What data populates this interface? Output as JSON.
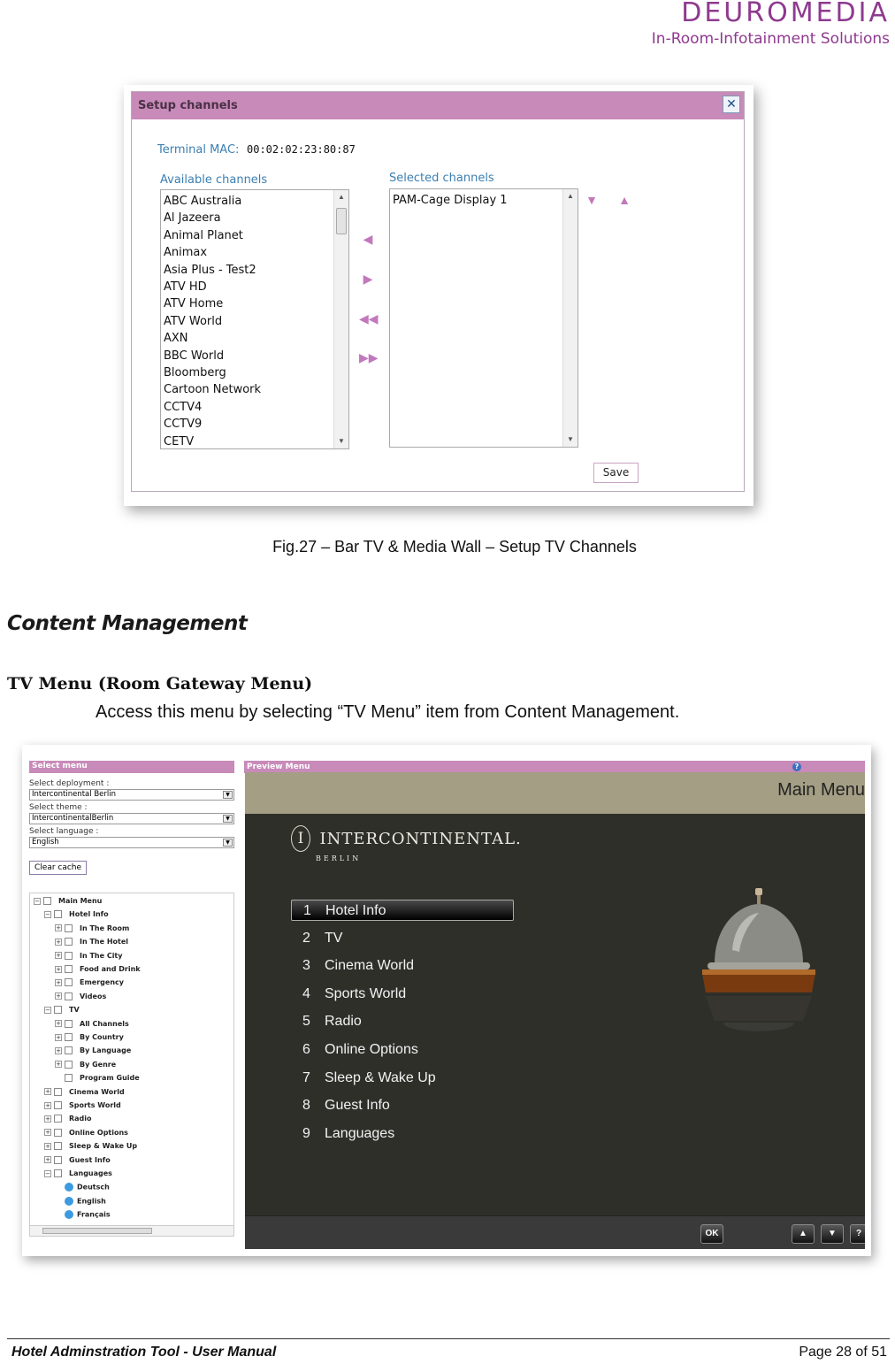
{
  "header": {
    "logo_text": "DEUROMEDIA",
    "logo_tagline": "In-Room-Infotainment Solutions",
    "brand_color": "#8e3a8f"
  },
  "dialog": {
    "title": "Setup channels",
    "close_icon": "close-icon",
    "terminal_mac_label": "Terminal MAC:",
    "terminal_mac_value": "00:02:02:23:80:87",
    "available_label": "Available channels",
    "selected_label": "Selected channels",
    "available_channels": [
      "ABC Australia",
      "Al Jazeera",
      "Animal Planet",
      "Animax",
      "Asia Plus - Test2",
      "ATV HD",
      "ATV Home",
      "ATV World",
      "AXN",
      "BBC World",
      "Bloomberg",
      "Cartoon Network",
      "CCTV4",
      "CCTV9",
      "CETV"
    ],
    "selected_channels": [
      "PAM-Cage Display 1"
    ],
    "save_label": "Save",
    "accent_color": "#c88ab9"
  },
  "caption": "Fig.27 – Bar TV & Media Wall – Setup TV Channels",
  "section_heading": "Content Management",
  "subsection_heading": "TV Menu (Room Gateway Menu)",
  "paragraph": "Access this menu by selecting “TV Menu” item from Content Management.",
  "screenshot": {
    "select_menu_title": "Select menu",
    "deployment_label": "Select deployment :",
    "deployment_value": "Intercontinental Berlin",
    "theme_label": "Select theme :",
    "theme_value": "IntercontinentalBerlin",
    "language_label": "Select language :",
    "language_value": "English",
    "clear_cache_label": "Clear cache",
    "tree": [
      "Main Menu",
      "Hotel Info",
      "In The Room",
      "In The Hotel",
      "In The City",
      "Food and Drink",
      "Emergency",
      "Videos",
      "TV",
      "All Channels",
      "By Country",
      "By Language",
      "By Genre",
      "Program Guide",
      "Cinema World",
      "Sports World",
      "Radio",
      "Online Options",
      "Sleep & Wake Up",
      "Guest Info",
      "Languages",
      "Deutsch",
      "English",
      "Français"
    ],
    "preview_title": "Preview Menu",
    "screen_title": "Main Menu",
    "brand_name": "INTERCONTINENTAL.",
    "brand_city": "BERLIN",
    "brand_mark": "I",
    "menu_items": [
      {
        "num": "1",
        "label": "Hotel Info"
      },
      {
        "num": "2",
        "label": "TV"
      },
      {
        "num": "3",
        "label": "Cinema World"
      },
      {
        "num": "4",
        "label": "Sports World"
      },
      {
        "num": "5",
        "label": "Radio"
      },
      {
        "num": "6",
        "label": "Online Options"
      },
      {
        "num": "7",
        "label": "Sleep & Wake Up"
      },
      {
        "num": "8",
        "label": "Guest Info"
      },
      {
        "num": "9",
        "label": "Languages"
      }
    ],
    "ok_label": "OK",
    "help_label": "?"
  },
  "footer": {
    "title": "Hotel Adminstration Tool - User Manual",
    "page": "Page 28 of 51"
  }
}
